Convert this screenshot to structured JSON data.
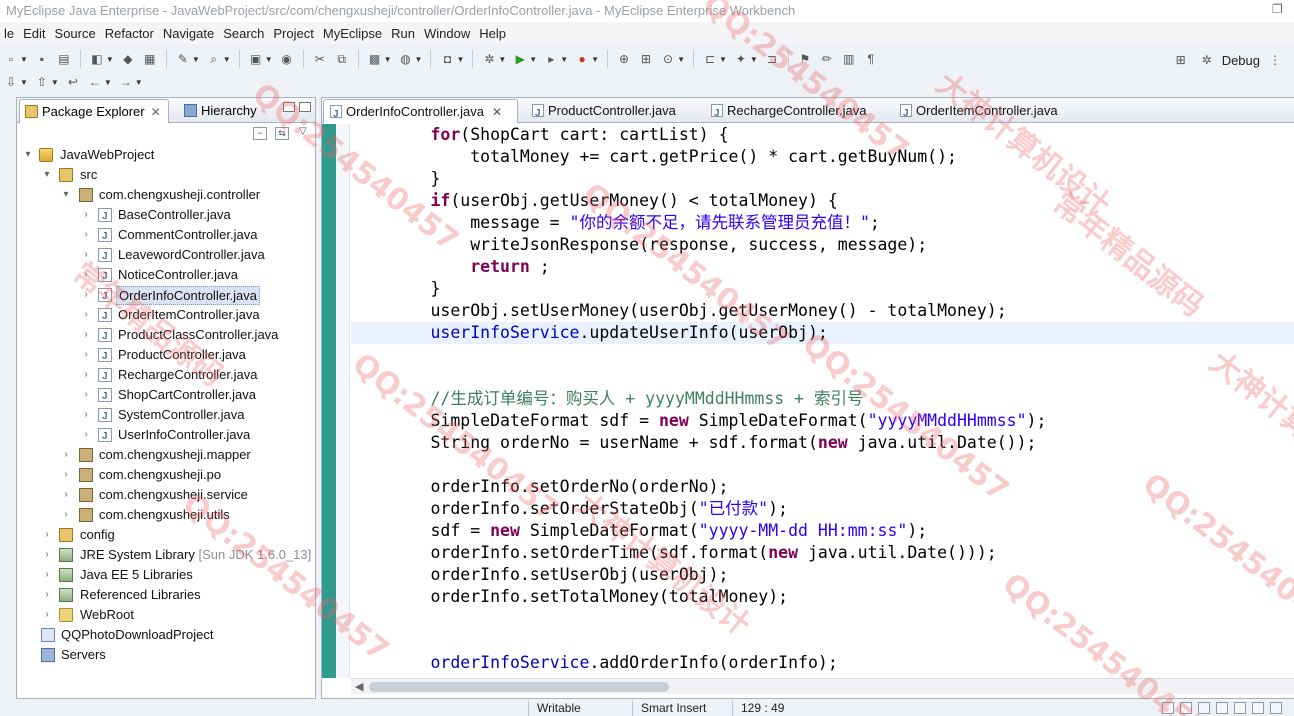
{
  "window": {
    "title": "MyEclipse Java Enterprise - JavaWebProject/src/com/chengxusheji/controller/OrderInfoController.java - MyEclipse Enterprise Workbench"
  },
  "menu": [
    "le",
    "Edit",
    "Source",
    "Refactor",
    "Navigate",
    "Search",
    "Project",
    "MyEclipse",
    "Run",
    "Window",
    "Help"
  ],
  "perspective": {
    "label": "Debug"
  },
  "package_explorer": {
    "tab_label": "Package Explorer",
    "hierarchy_label": "Hierarchy",
    "tree": [
      {
        "label": "JavaWebProject",
        "suffix": ""
      },
      {
        "label": "src",
        "suffix": ""
      },
      {
        "label": "com.chengxusheji.controller",
        "suffix": ""
      },
      {
        "label": "BaseController.java",
        "suffix": ""
      },
      {
        "label": "CommentController.java",
        "suffix": ""
      },
      {
        "label": "LeavewordController.java",
        "suffix": ""
      },
      {
        "label": "NoticeController.java",
        "suffix": ""
      },
      {
        "label": "OrderInfoController.java",
        "suffix": ""
      },
      {
        "label": "OrderItemController.java",
        "suffix": ""
      },
      {
        "label": "ProductClassController.java",
        "suffix": ""
      },
      {
        "label": "ProductController.java",
        "suffix": ""
      },
      {
        "label": "RechargeController.java",
        "suffix": ""
      },
      {
        "label": "ShopCartController.java",
        "suffix": ""
      },
      {
        "label": "SystemController.java",
        "suffix": ""
      },
      {
        "label": "UserInfoController.java",
        "suffix": ""
      },
      {
        "label": "com.chengxusheji.mapper",
        "suffix": ""
      },
      {
        "label": "com.chengxusheji.po",
        "suffix": ""
      },
      {
        "label": "com.chengxusheji.service",
        "suffix": ""
      },
      {
        "label": "com.chengxusheji.utils",
        "suffix": ""
      },
      {
        "label": "config",
        "suffix": ""
      },
      {
        "label": "JRE System Library",
        "suffix": "[Sun JDK 1.6.0_13]"
      },
      {
        "label": "Java EE 5 Libraries",
        "suffix": ""
      },
      {
        "label": "Referenced Libraries",
        "suffix": ""
      },
      {
        "label": "WebRoot",
        "suffix": ""
      },
      {
        "label": "QQPhotoDownloadProject",
        "suffix": ""
      },
      {
        "label": "Servers",
        "suffix": ""
      }
    ]
  },
  "editor": {
    "tabs": [
      "OrderInfoController.java",
      "ProductController.java",
      "RechargeController.java",
      "OrderItemController.java"
    ],
    "code_lines": [
      "        for(ShopCart cart: cartList) {",
      "            totalMoney += cart.getPrice() * cart.getBuyNum();",
      "        }",
      "        if(userObj.getUserMoney() < totalMoney) {",
      "            message = \"你的余额不足，请先联系管理员充值！\";",
      "            writeJsonResponse(response, success, message);",
      "            return ;",
      "        }",
      "        userObj.setUserMoney(userObj.getUserMoney() - totalMoney);",
      "        userInfoService.updateUserInfo(userObj);",
      "",
      "",
      "        //生成订单编号：购买人 + yyyyMMddHHmmss + 索引号",
      "        SimpleDateFormat sdf = new SimpleDateFormat(\"yyyyMMddHHmmss\");",
      "        String orderNo = userName + sdf.format(new java.util.Date());",
      "",
      "        orderInfo.setOrderNo(orderNo);",
      "        orderInfo.setOrderStateObj(\"已付款\");",
      "        sdf = new SimpleDateFormat(\"yyyy-MM-dd HH:mm:ss\");",
      "        orderInfo.setOrderTime(sdf.format(new java.util.Date()));",
      "        orderInfo.setUserObj(userObj);",
      "        orderInfo.setTotalMoney(totalMoney);",
      "",
      "",
      "        orderInfoService.addOrderInfo(orderInfo);"
    ]
  },
  "status": {
    "mode": "Writable",
    "insert": "Smart Insert",
    "position": "129 : 49"
  },
  "watermark": [
    "QQ:254540457",
    "大神计算机设计",
    "常年精品源码",
    "大神计算机"
  ]
}
